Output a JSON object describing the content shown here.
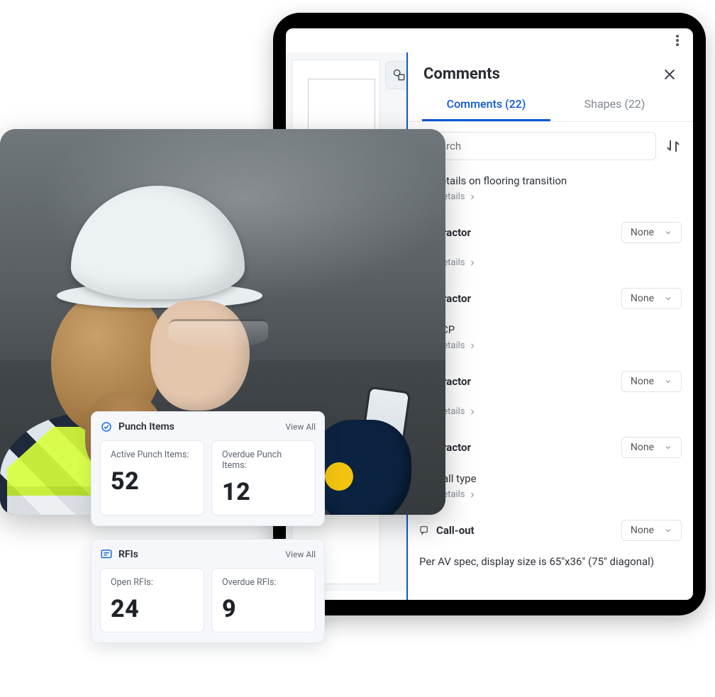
{
  "tablet": {
    "comments": {
      "title": "Comments",
      "tabs": {
        "comments": "Comments (22)",
        "shapes": "Shapes (22)"
      },
      "search_placeholder": "Search",
      "dropdown_value": "None",
      "see_details": "See Details",
      "rows": [
        {
          "text": "…e details on flooring transition",
          "see": true
        },
        {
          "head": "…ontractor",
          "none": true
        },
        {
          "see_only": true
        },
        {
          "head": "…ontractor",
          "none": true
        },
        {
          "text": "…e RCP",
          "see": true
        },
        {
          "head": "…ontractor",
          "none": true
        },
        {
          "see_only": true
        },
        {
          "head": "…ontractor",
          "none": true
        },
        {
          "text": "…e wall type",
          "see": true
        },
        {
          "callout": "Call-out",
          "none": true
        },
        {
          "text": "Per AV spec, display size is 65\"x36\" (75\" diagonal)"
        }
      ]
    }
  },
  "cards": {
    "punch": {
      "title": "Punch Items",
      "view_all": "View All",
      "active_label": "Active Punch Items:",
      "active_value": "52",
      "overdue_label": "Overdue Punch Items:",
      "overdue_value": "12"
    },
    "rfis": {
      "title": "RFIs",
      "view_all": "View All",
      "open_label": "Open RFIs:",
      "open_value": "24",
      "overdue_label": "Overdue RFIs:",
      "overdue_value": "9"
    }
  }
}
